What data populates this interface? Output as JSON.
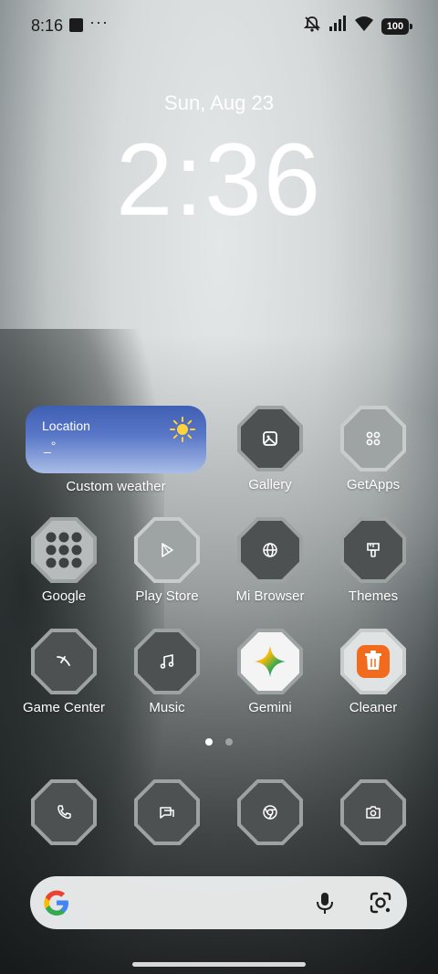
{
  "status_bar": {
    "time": "8:16",
    "dots": "···",
    "battery": "100",
    "icons": [
      "square-notification-icon",
      "mute-icon",
      "signal-icon",
      "wifi-icon",
      "battery-icon"
    ]
  },
  "clock": {
    "date": "Sun, Aug 23",
    "time": "2:36"
  },
  "weather_widget": {
    "location": "Location",
    "temperature": "_°",
    "label": "Custom weather",
    "icon": "sun-icon"
  },
  "apps": [
    {
      "label": "Gallery",
      "icon": "gallery-icon"
    },
    {
      "label": "GetApps",
      "icon": "getapps-icon"
    },
    {
      "label": "Google",
      "icon": "google-folder-icon"
    },
    {
      "label": "Play Store",
      "icon": "play-store-icon"
    },
    {
      "label": "Mi Browser",
      "icon": "globe-icon"
    },
    {
      "label": "Themes",
      "icon": "themes-brush-icon"
    },
    {
      "label": "Game Center",
      "icon": "game-center-icon"
    },
    {
      "label": "Music",
      "icon": "music-note-icon"
    },
    {
      "label": "Gemini",
      "icon": "gemini-star-icon"
    },
    {
      "label": "Cleaner",
      "icon": "cleaner-trash-icon"
    }
  ],
  "pages": {
    "count": 2,
    "current": 1
  },
  "dock": [
    {
      "icon": "phone-icon"
    },
    {
      "icon": "messages-icon"
    },
    {
      "icon": "chrome-icon"
    },
    {
      "icon": "camera-icon"
    }
  ],
  "search_bar": {
    "icons": [
      "google-g-icon",
      "microphone-icon",
      "google-lens-icon"
    ]
  },
  "colors": {
    "weather_top": "#3f5fb3",
    "weather_bottom": "#a9bde6",
    "cleaner": "#f26b1d"
  }
}
